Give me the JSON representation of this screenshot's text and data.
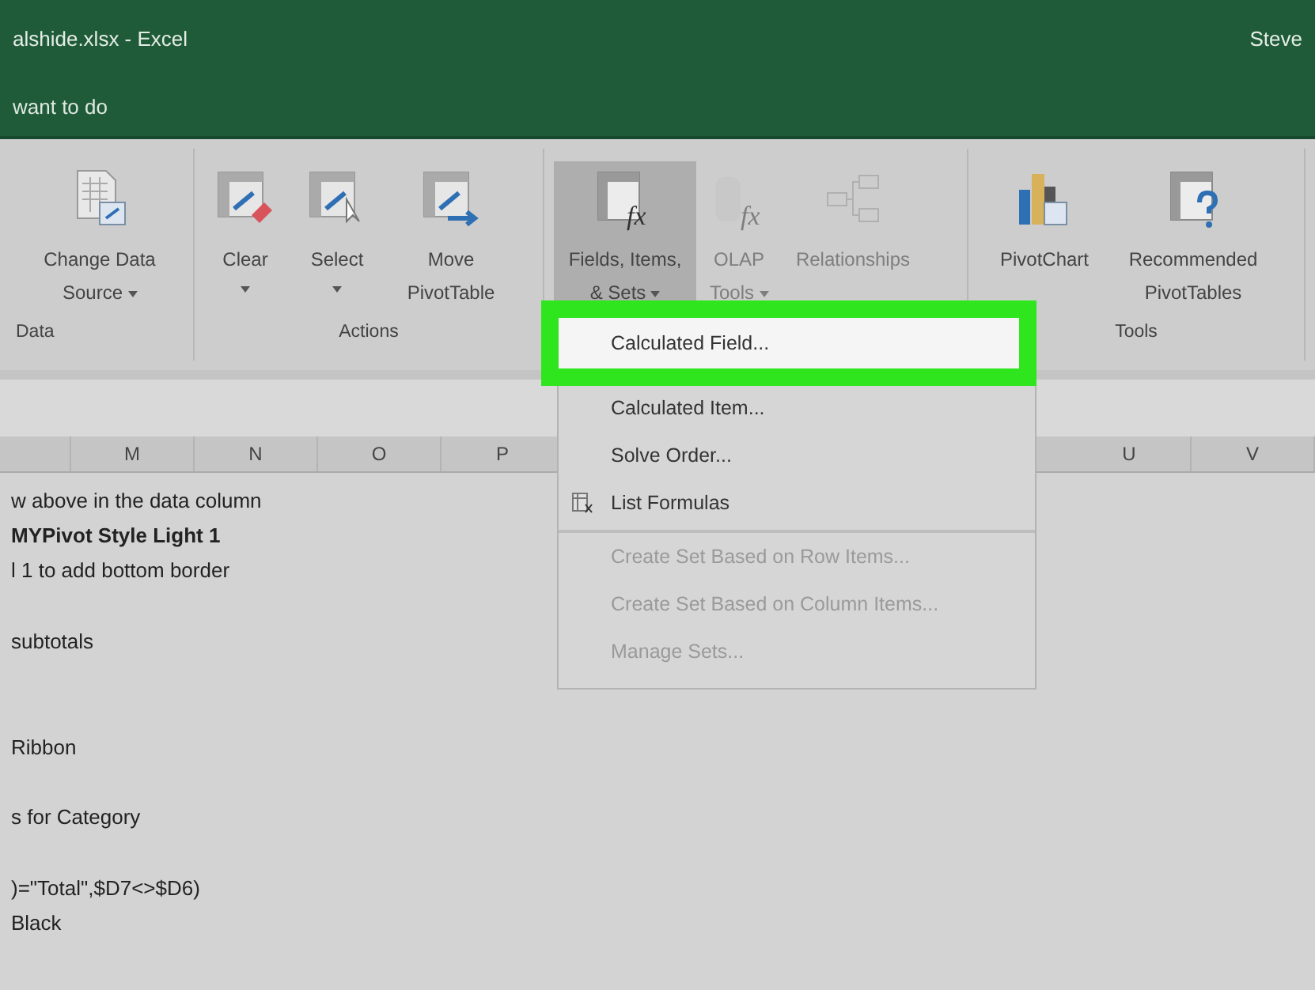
{
  "window": {
    "title": "alshide.xlsx  -  Excel",
    "user": "Steve"
  },
  "tell_me": {
    "placeholder": "want to do"
  },
  "ribbon": {
    "groups": [
      {
        "label": "Data",
        "buttons": [
          {
            "kind": "change-data",
            "lines": [
              "Change Data",
              "Source"
            ],
            "dropdown": true,
            "disabled": false,
            "pressed": false
          }
        ]
      },
      {
        "label": "Actions",
        "buttons": [
          {
            "kind": "clear",
            "lines": [
              "Clear"
            ],
            "dropdown": true,
            "disabled": false,
            "pressed": false
          },
          {
            "kind": "select",
            "lines": [
              "Select"
            ],
            "dropdown": true,
            "disabled": false,
            "pressed": false
          },
          {
            "kind": "move",
            "lines": [
              "Move",
              "PivotTable"
            ],
            "dropdown": false,
            "disabled": false,
            "pressed": false
          }
        ]
      },
      {
        "buttons": [
          {
            "kind": "fields",
            "glyph": "fx",
            "lines": [
              "Fields, Items,",
              "& Sets"
            ],
            "dropdown": true,
            "disabled": false,
            "pressed": true
          },
          {
            "kind": "olap",
            "glyph": "fx",
            "lines": [
              "OLAP",
              "Tools"
            ],
            "dropdown": true,
            "disabled": true,
            "pressed": false
          },
          {
            "kind": "relationships",
            "lines": [
              "Relationships"
            ],
            "dropdown": false,
            "disabled": true,
            "pressed": false
          }
        ]
      },
      {
        "label": "Tools",
        "buttons": [
          {
            "kind": "pivotchart",
            "lines": [
              "PivotChart"
            ],
            "dropdown": false,
            "disabled": false,
            "pressed": false
          },
          {
            "kind": "recommended",
            "lines": [
              "Recommended",
              "PivotTables"
            ],
            "dropdown": false,
            "disabled": false,
            "pressed": false
          }
        ]
      }
    ]
  },
  "columns": [
    {
      "label": "M"
    },
    {
      "label": "N"
    },
    {
      "label": "O"
    },
    {
      "label": "P"
    },
    {
      "label": "U"
    },
    {
      "label": "V"
    }
  ],
  "rows": [
    {
      "text": "w above in the data column",
      "bold": false
    },
    {
      "text": "MYPivot Style Light 1",
      "bold": true
    },
    {
      "text": "l 1 to add bottom border",
      "bold": false
    },
    {},
    {
      "text": "subtotals",
      "bold": false
    },
    {},
    {},
    {
      "text": "Ribbon",
      "bold": false
    },
    {},
    {
      "text": "s for Category",
      "bold": false
    },
    {},
    {
      "text": ")=\"Total\",$D7<>$D6)",
      "bold": false
    },
    {
      "text": "Black",
      "bold": false
    }
  ],
  "menu": {
    "items": [
      {
        "label": "Calculated Field...",
        "disabled": false,
        "highlighted": true,
        "icon": false,
        "separator_before": false
      },
      {
        "label": "Calculated Item...",
        "disabled": false,
        "highlighted": false,
        "icon": false,
        "separator_before": false
      },
      {
        "label": "Solve Order...",
        "disabled": false,
        "highlighted": false,
        "icon": false,
        "separator_before": false
      },
      {
        "label": "List Formulas",
        "disabled": false,
        "highlighted": false,
        "icon": true,
        "separator_before": false
      },
      {
        "label": "Create Set Based on Row Items...",
        "disabled": true,
        "highlighted": false,
        "icon": false,
        "separator_before": true
      },
      {
        "label": "Create Set Based on Column Items...",
        "disabled": true,
        "highlighted": false,
        "icon": false,
        "separator_before": false
      },
      {
        "label": "Manage Sets...",
        "disabled": true,
        "highlighted": false,
        "icon": false,
        "separator_before": false
      }
    ]
  }
}
